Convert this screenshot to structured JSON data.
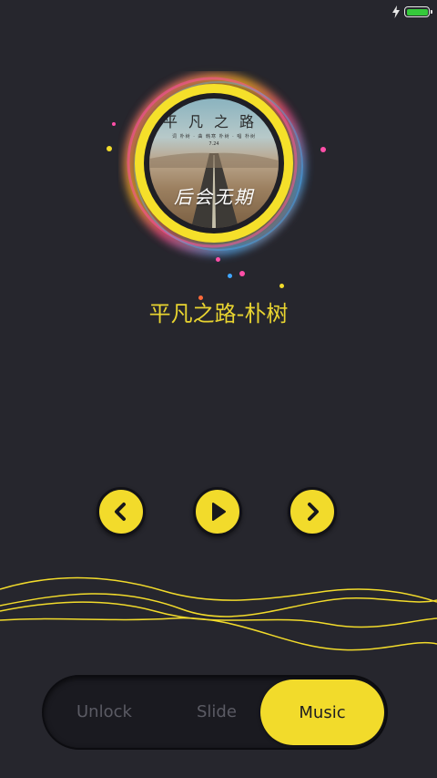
{
  "colors": {
    "background": "#26262d",
    "accent_yellow": "#f2db2b",
    "title_yellow": "#e8d430",
    "battery_green": "#35c93b"
  },
  "status_bar": {
    "charging_icon": "lightning-bolt-icon",
    "battery_icon": "battery-full-icon"
  },
  "album": {
    "cover_title": "平凡之路",
    "cover_meta": "词 朴树 · 曲 韩寒 朴树 · 唱 朴树",
    "cover_date": "7.24",
    "cover_script": "后会无期"
  },
  "song": {
    "title": "平凡之路-朴树"
  },
  "controls": {
    "prev_icon": "chevron-left-icon",
    "play_icon": "play-icon",
    "next_icon": "chevron-right-icon"
  },
  "slider": {
    "options": [
      "Unlock",
      "Slide",
      "Music"
    ],
    "selected": "Music"
  }
}
